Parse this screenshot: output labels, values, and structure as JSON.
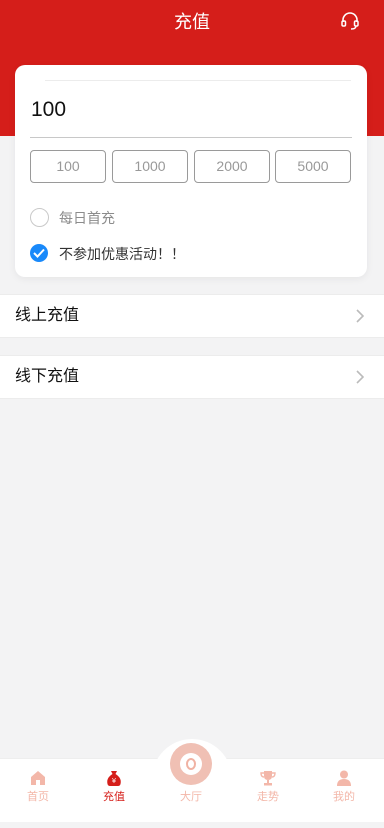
{
  "header": {
    "title": "充值",
    "icon": "headset-icon"
  },
  "recharge": {
    "amount": "100",
    "presets": [
      "100",
      "1000",
      "2000",
      "5000"
    ],
    "options": [
      {
        "label": "每日首充",
        "checked": false
      },
      {
        "label": "不参加优惠活动！！",
        "checked": true
      }
    ]
  },
  "methods": [
    {
      "label": "线上充值"
    },
    {
      "label": "线下充值"
    }
  ],
  "tabbar": {
    "items": [
      {
        "label": "首页",
        "icon": "home-icon"
      },
      {
        "label": "充值",
        "icon": "money-bag-icon",
        "active": true
      },
      {
        "label": "大厅",
        "icon": "lobby-icon"
      },
      {
        "label": "走势",
        "icon": "trophy-icon"
      },
      {
        "label": "我的",
        "icon": "user-icon"
      }
    ]
  },
  "colors": {
    "brand": "#d51e1a",
    "check": "#1989fa",
    "tab_inactive": "#f3b7a9"
  }
}
